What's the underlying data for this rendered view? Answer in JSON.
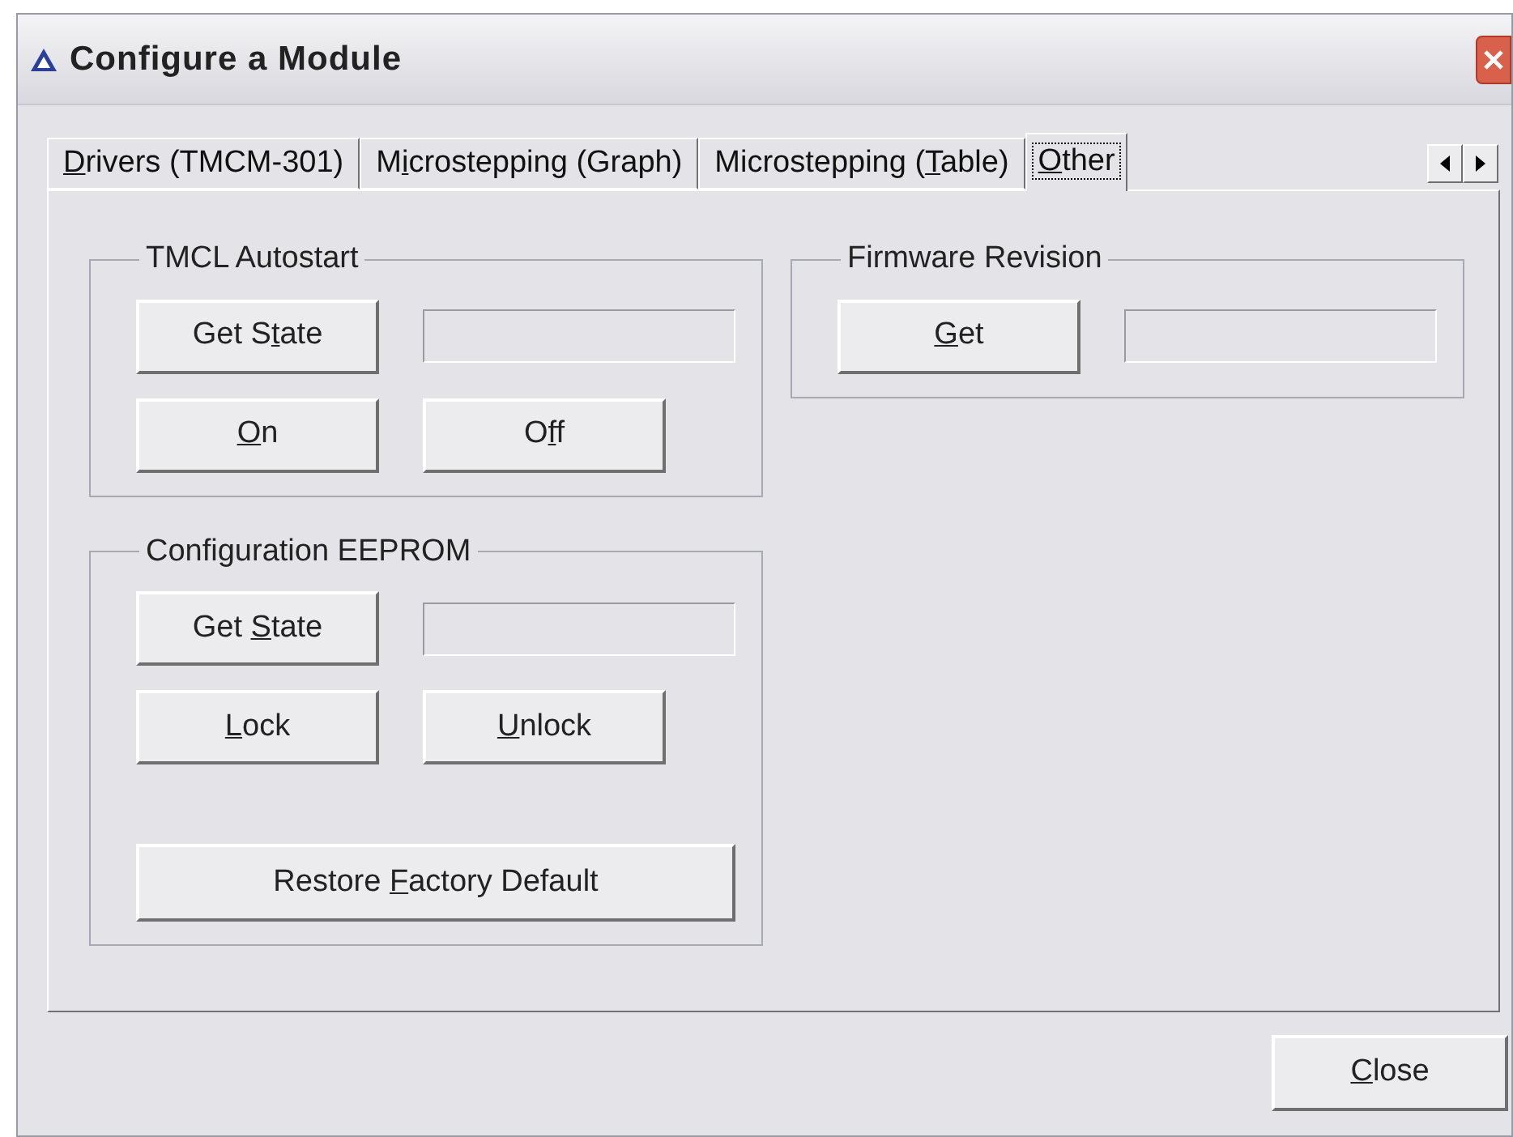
{
  "window": {
    "title": "Configure a Module"
  },
  "tabs": [
    {
      "label": {
        "key": "D",
        "post": "rivers (TMCM-301)"
      },
      "selected": false
    },
    {
      "label": {
        "pre": "M",
        "key": "i",
        "post": "crostepping (Graph)"
      },
      "selected": false
    },
    {
      "label": {
        "pre": "Microstepping (",
        "key": "T",
        "post": "able)"
      },
      "selected": false
    },
    {
      "label": {
        "key": "O",
        "post": "ther"
      },
      "selected": true
    }
  ],
  "left_column": [
    {
      "title": "TMCL Autostart",
      "items": [
        {
          "kind": "button",
          "label": {
            "pre": "Get S",
            "key": "t",
            "post": "ate"
          }
        },
        {
          "kind": "field"
        },
        {
          "kind": "button",
          "label": {
            "key": "O",
            "post": "n"
          }
        },
        {
          "kind": "button",
          "label": {
            "pre": "O",
            "key": "f",
            "post": "f"
          }
        }
      ]
    },
    {
      "title": "Configuration EEPROM",
      "items": [
        {
          "kind": "button",
          "label": {
            "pre": "Get ",
            "key": "S",
            "post": "tate"
          }
        },
        {
          "kind": "field"
        },
        {
          "kind": "button",
          "label": {
            "key": "L",
            "post": "ock"
          }
        },
        {
          "kind": "button",
          "label": {
            "key": "U",
            "post": "nlock"
          }
        },
        {
          "kind": "wide_button",
          "label": {
            "pre": "Restore ",
            "key": "F",
            "post": "actory Default"
          }
        }
      ]
    }
  ],
  "right_column": [
    {
      "title": "Firmware Revision",
      "items": [
        {
          "kind": "button",
          "label": {
            "key": "G",
            "post": "et"
          }
        },
        {
          "kind": "field"
        }
      ]
    }
  ],
  "footer_buttons": [
    {
      "label": {
        "key": "C",
        "post": "lose"
      }
    }
  ]
}
